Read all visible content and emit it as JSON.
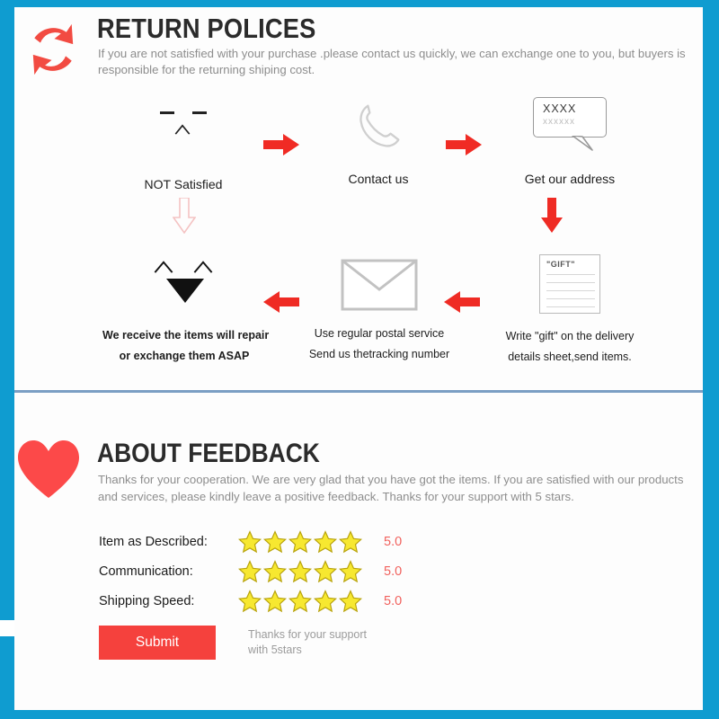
{
  "theme": {
    "frame_color": "#0f9cd0",
    "divider_color": "#7b9fc4",
    "accent_red": "#f5413d",
    "star_fill": "#f7e830",
    "star_stroke": "#b8a30c",
    "score_color": "#f1625e",
    "body_text": "#8d8d8d",
    "title_text": "#2b2b2b"
  },
  "return_section": {
    "icon": "recycle-arrows-icon",
    "title": "RETURN POLICES",
    "subtitle": "If you are not satisfied with your purchase .please contact us quickly, we can exchange one to you, but buyers is responsible for the returning shiping cost.",
    "steps": [
      {
        "id": "not-satisfied",
        "icon": "sad-face-icon",
        "caption": "NOT Satisfied"
      },
      {
        "id": "contact-us",
        "icon": "telephone-icon",
        "caption": "Contact us"
      },
      {
        "id": "get-address",
        "icon": "speech-bubble-icon",
        "bubble_line1": "XXXX",
        "bubble_line2": "xxxxxx",
        "caption": "Get our address"
      },
      {
        "id": "write-gift",
        "icon": "document-icon",
        "doc_label": "\"GIFT\"",
        "caption_line1": "Write \"gift\" on the delivery",
        "caption_line2": "details sheet,send items."
      },
      {
        "id": "postal-service",
        "icon": "envelope-icon",
        "caption_line1": "Use regular postal service",
        "caption_line2": "Send us thetracking number"
      },
      {
        "id": "repair-exchange",
        "icon": "happy-face-icon",
        "caption_line1": "We receive the items will repair",
        "caption_line2": "or exchange them ASAP"
      }
    ],
    "connectors": [
      {
        "id": "arrow-right-1",
        "icon": "arrow-right-icon",
        "style": "solid-red"
      },
      {
        "id": "arrow-right-2",
        "icon": "arrow-right-icon",
        "style": "solid-red"
      },
      {
        "id": "arrow-down-right",
        "icon": "arrow-down-icon",
        "style": "solid-red"
      },
      {
        "id": "arrow-left-1",
        "icon": "arrow-left-icon",
        "style": "solid-red"
      },
      {
        "id": "arrow-left-2",
        "icon": "arrow-left-icon",
        "style": "solid-red"
      },
      {
        "id": "arrow-down-left",
        "icon": "arrow-down-icon",
        "style": "outline-pink"
      }
    ]
  },
  "feedback_section": {
    "icon": "heart-icon",
    "title": "ABOUT FEEDBACK",
    "subtitle": "Thanks for your cooperation. We are very glad that you have got the items. If you are satisfied with our products and services, please kindly leave a positive feedback. Thanks for your support with 5 stars.",
    "ratings": [
      {
        "label": "Item as Described:",
        "stars": 5,
        "score": "5.0"
      },
      {
        "label": "Communication:",
        "stars": 5,
        "score": "5.0"
      },
      {
        "label": "Shipping Speed:",
        "stars": 5,
        "score": "5.0"
      }
    ],
    "submit_label": "Submit",
    "submit_note": "Thanks for your support\nwith 5stars"
  }
}
